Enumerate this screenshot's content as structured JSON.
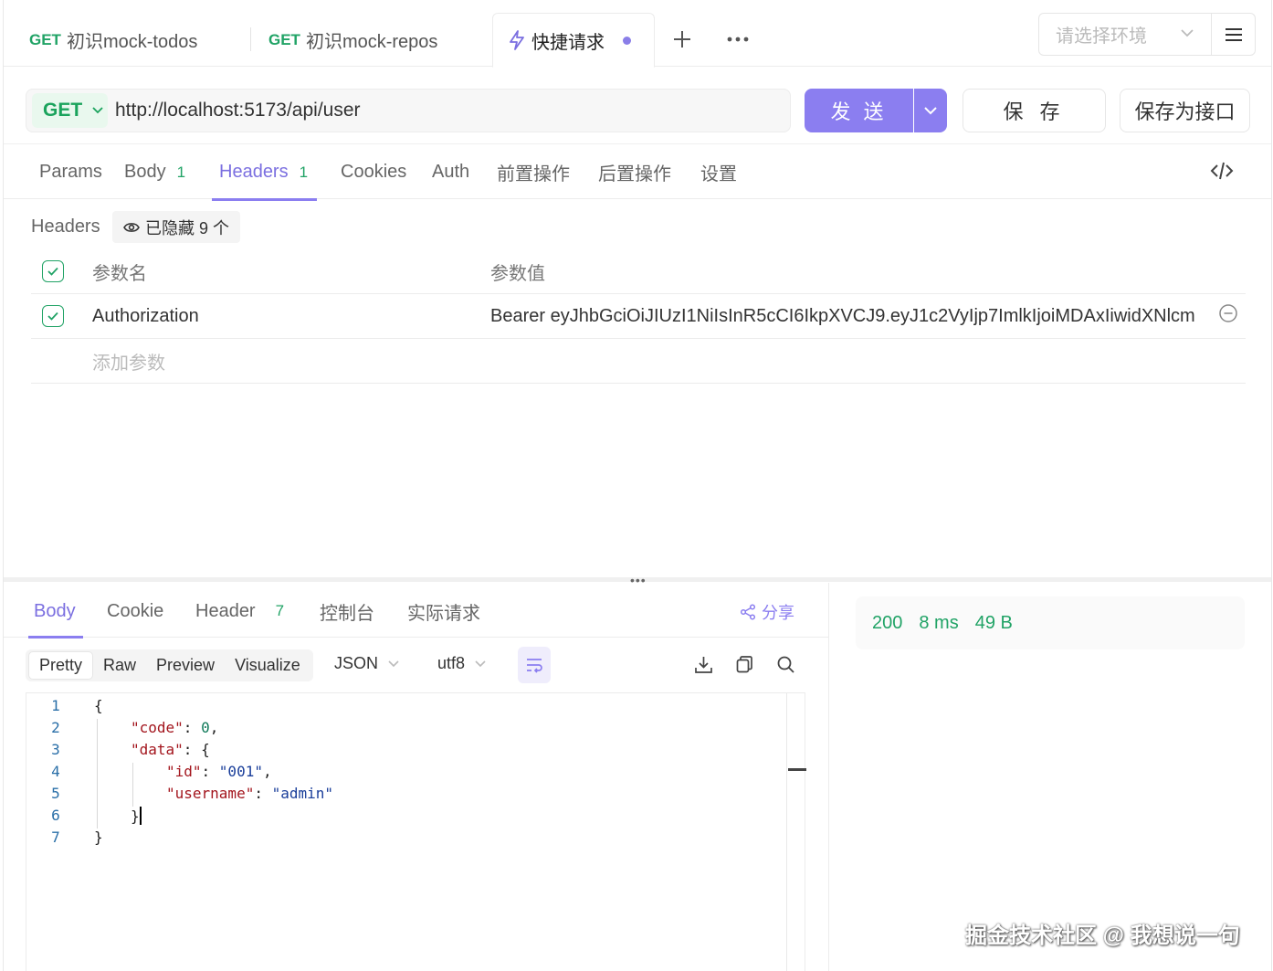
{
  "tabs": [
    {
      "method": "GET",
      "label": "初识mock-todos"
    },
    {
      "method": "GET",
      "label": "初识mock-repos"
    },
    {
      "label": "快捷请求"
    }
  ],
  "env_select": {
    "placeholder": "请选择环境"
  },
  "request": {
    "method": "GET",
    "url": "http://localhost:5173/api/user",
    "send_label": "发 送",
    "save_label": "保 存",
    "save_api_label": "保存为接口"
  },
  "request_tabs": [
    {
      "label": "Params",
      "badge": ""
    },
    {
      "label": "Body",
      "badge": "1"
    },
    {
      "label": "Headers",
      "badge": "1"
    },
    {
      "label": "Cookies",
      "badge": ""
    },
    {
      "label": "Auth",
      "badge": ""
    },
    {
      "label": "前置操作",
      "badge": ""
    },
    {
      "label": "后置操作",
      "badge": ""
    },
    {
      "label": "设置",
      "badge": ""
    }
  ],
  "headers_panel": {
    "title": "Headers",
    "hidden_chip": "已隐藏 9 个",
    "col_name": "参数名",
    "col_value": "参数值",
    "rows": [
      {
        "name": "Authorization",
        "value": "Bearer eyJhbGciOiJIUzI1NiIsInR5cCI6IkpXVCJ9.eyJ1c2VyIjp7ImlkIjoiMDAxIiwidXNlcm"
      }
    ],
    "add_placeholder": "添加参数"
  },
  "response_tabs": [
    {
      "label": "Body",
      "badge": ""
    },
    {
      "label": "Cookie",
      "badge": ""
    },
    {
      "label": "Header",
      "badge": "7"
    },
    {
      "label": "控制台",
      "badge": ""
    },
    {
      "label": "实际请求",
      "badge": ""
    }
  ],
  "share_label": "分享",
  "views": [
    "Pretty",
    "Raw",
    "Preview",
    "Visualize"
  ],
  "format": "JSON",
  "encoding": "utf8",
  "status": {
    "code": "200",
    "time": "8 ms",
    "size": "49 B"
  },
  "code_lines": [
    "1",
    "2",
    "3",
    "4",
    "5",
    "6",
    "7"
  ],
  "json": {
    "open": "{",
    "k_code": "\"code\"",
    "v_code": "0",
    "k_data": "\"data\"",
    "k_id": "\"id\"",
    "v_id": "\"001\"",
    "k_username": "\"username\"",
    "v_username": "\"admin\"",
    "close_inner": "}",
    "close": "}"
  },
  "watermark": "掘金技术社区 @ 我想说一句",
  "colors": {
    "accent": "#8b7ef0",
    "method_green": "#21a366"
  }
}
